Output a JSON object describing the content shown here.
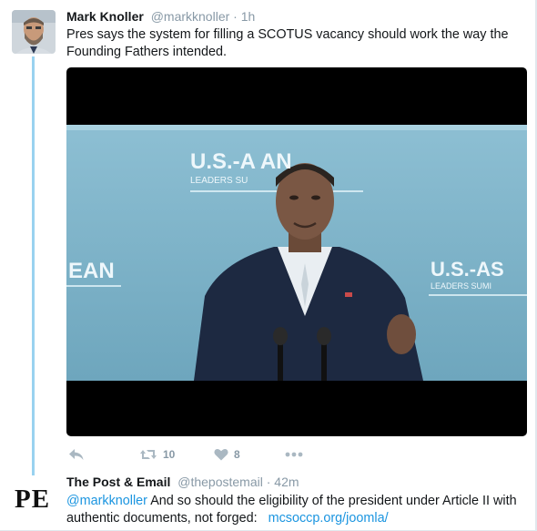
{
  "tweet": {
    "author_name": "Mark Knoller",
    "author_handle": "@markknoller",
    "separator": "·",
    "time": "1h",
    "text": "Pres says the system for filling a SCOTUS vacancy should work the way the Founding Fathers intended.",
    "media": {
      "banner_text_top": "U.S.-A    AN",
      "banner_subtext_top": "LEADERS SU",
      "banner_text_left": "EAN",
      "banner_text_right": "U.S.-AS",
      "banner_subtext_right": "LEADERS SUMI"
    },
    "actions": {
      "reply_icon": "reply-icon",
      "retweet_icon": "retweet-icon",
      "retweet_count": "10",
      "like_icon": "heart-icon",
      "like_count": "8",
      "more_icon": "more-icon"
    }
  },
  "reply": {
    "logo_text": "PE",
    "author_name": "The Post & Email",
    "author_handle": "@thepostemail",
    "separator": "·",
    "time": "42m",
    "mention": "@markknoller",
    "text": "And so should the eligibility of the president under Article II with authentic documents, not forged:",
    "link_text": "mcsoccp.org/joomla/"
  },
  "colors": {
    "thread_line": "#99d2f0",
    "link": "#1b95e0",
    "muted": "#8899a6",
    "banner_blue": "#7ab0c8"
  }
}
